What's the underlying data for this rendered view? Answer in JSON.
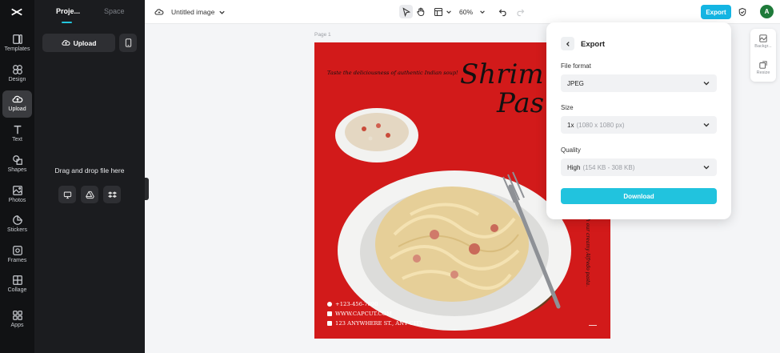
{
  "rail": {
    "items": [
      {
        "label": "Templates",
        "icon": "templates-icon"
      },
      {
        "label": "Design",
        "icon": "design-icon"
      },
      {
        "label": "Upload",
        "icon": "upload-icon"
      },
      {
        "label": "Text",
        "icon": "text-icon"
      },
      {
        "label": "Shapes",
        "icon": "shapes-icon"
      },
      {
        "label": "Photos",
        "icon": "photos-icon"
      },
      {
        "label": "Stickers",
        "icon": "stickers-icon"
      },
      {
        "label": "Frames",
        "icon": "frames-icon"
      },
      {
        "label": "Collage",
        "icon": "collage-icon"
      },
      {
        "label": "Apps",
        "icon": "apps-icon"
      }
    ],
    "active": "Upload"
  },
  "panel": {
    "tabs": [
      {
        "label": "Proje..."
      },
      {
        "label": "Space"
      }
    ],
    "upload_label": "Upload",
    "drop_text": "Drag and drop file here"
  },
  "topbar": {
    "doc_title": "Untitled image",
    "zoom": "60%",
    "export_label": "Export",
    "avatar_initial": "A"
  },
  "canvas": {
    "page_label": "Page 1",
    "headline_1": "Shrim",
    "headline_2": "Pas",
    "tagline": "Taste the deliciousness of authentic Indian soup!",
    "vertical_text": "ish our creamy Alfredo pasta.",
    "contacts": [
      {
        "text": "+123-456-7890",
        "icon": "phone-icon"
      },
      {
        "text": "WWW.CAPCUT.COM",
        "icon": "web-icon"
      },
      {
        "text": "123 ANYWHERE ST., ANY CITY",
        "icon": "location-icon"
      }
    ]
  },
  "minitools": [
    {
      "label": "Backgr...",
      "icon": "background-icon"
    },
    {
      "label": "Resize",
      "icon": "resize-icon"
    }
  ],
  "export_panel": {
    "title": "Export",
    "file_format_label": "File format",
    "file_format_value": "JPEG",
    "size_label": "Size",
    "size_value": "1x",
    "size_hint": "(1080 x 1080 px)",
    "quality_label": "Quality",
    "quality_value": "High",
    "quality_hint": "(154 KB - 308 KB)",
    "download_label": "Download"
  },
  "colors": {
    "accent": "#21c3de",
    "export_button": "#14b5e3",
    "artboard_bg": "#d21a1a",
    "rail_bg": "#111214",
    "panel_bg": "#1b1c1f",
    "avatar_bg": "#1f7a3a"
  }
}
